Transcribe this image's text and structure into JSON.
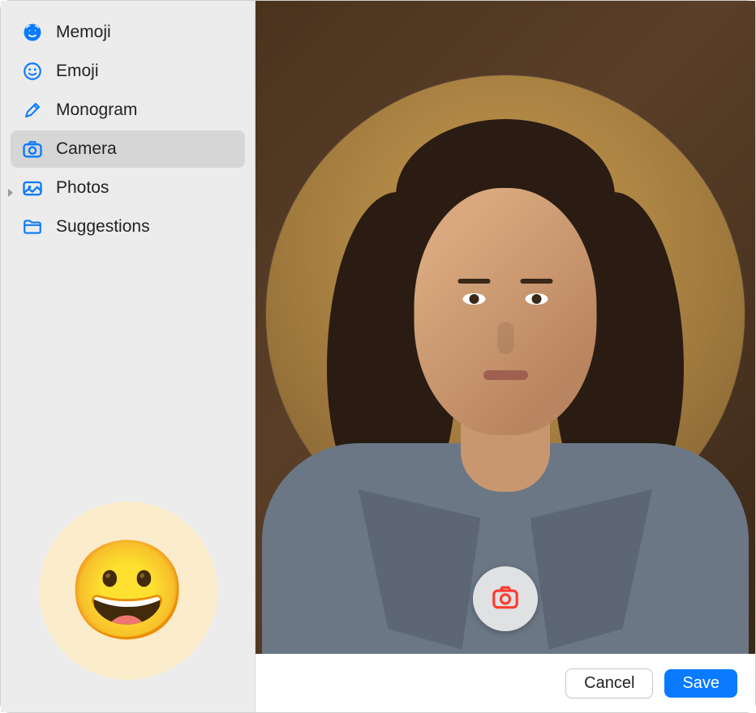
{
  "sidebar": {
    "items": [
      {
        "label": "Memoji",
        "icon": "memoji-icon",
        "selected": false,
        "disclosure": false
      },
      {
        "label": "Emoji",
        "icon": "emoji-icon",
        "selected": false,
        "disclosure": false
      },
      {
        "label": "Monogram",
        "icon": "pencil-icon",
        "selected": false,
        "disclosure": false
      },
      {
        "label": "Camera",
        "icon": "camera-icon",
        "selected": true,
        "disclosure": false
      },
      {
        "label": "Photos",
        "icon": "photos-icon",
        "selected": false,
        "disclosure": true
      },
      {
        "label": "Suggestions",
        "icon": "folder-icon",
        "selected": false,
        "disclosure": false
      }
    ]
  },
  "current_avatar": {
    "emoji": "😀"
  },
  "buttons": {
    "cancel": "Cancel",
    "save": "Save"
  },
  "capture": {
    "icon": "camera-capture-icon"
  }
}
